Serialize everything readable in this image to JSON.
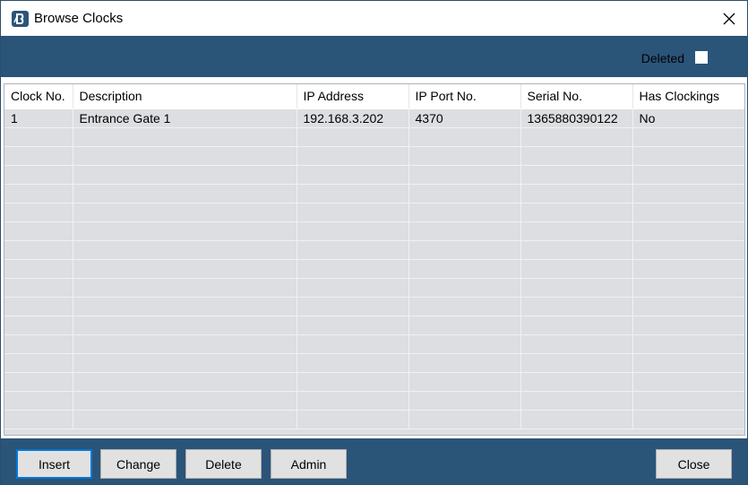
{
  "window": {
    "title": "Browse Clocks",
    "icon": "app-logo-icon",
    "close_icon": "close-icon"
  },
  "filter": {
    "deleted_label": "Deleted",
    "deleted_checked": false
  },
  "grid": {
    "columns": [
      "Clock No.",
      "Description",
      "IP Address",
      "IP Port No.",
      "Serial No.",
      "Has Clockings"
    ],
    "rows": [
      [
        "1",
        "Entrance Gate 1",
        "192.168.3.202",
        "4370",
        "1365880390122",
        "No"
      ]
    ],
    "selected_row_index": 0
  },
  "buttons": {
    "insert": "Insert",
    "change": "Change",
    "delete": "Delete",
    "admin": "Admin",
    "close": "Close"
  },
  "colors": {
    "accent": "#2b5479",
    "grid_background": "#dcdee1",
    "focus_border": "#0078d7"
  }
}
